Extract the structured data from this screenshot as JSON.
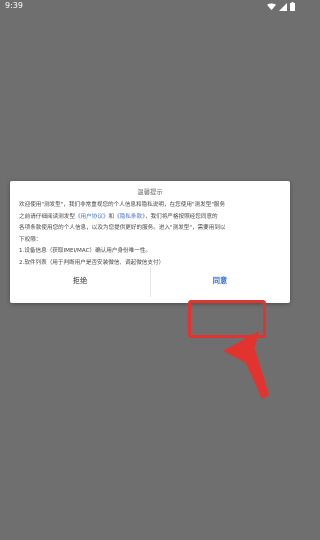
{
  "status_bar": {
    "time": "9:39"
  },
  "dialog": {
    "title": "温馨提示",
    "body": {
      "line1": "欢迎使用\"测发型\"，我们非常重视您的个人信息和隐私说明，在您使用\"测发型\"服务",
      "line2_prefix": "之前请仔细阅读测发型",
      "link_user_agreement": "《用户协议》",
      "line2_and": "和",
      "link_privacy": "《隐私条款》",
      "line2_suffix": "，我们将严格按照经您同意的",
      "line3": "各项条款使用您的个人信息，以及为您提供更好的服务。进入\"测发型\"，需要用到以",
      "line4": "下权限：",
      "line5": "1.设备信息（获取IMEI/MAC）确认用户身份唯一性。",
      "line6": "2.软件列表（用于判断用户是否安装微信、调起微信支付）"
    },
    "reject_label": "拒绝",
    "agree_label": "同意"
  },
  "annotation": {
    "highlight_color": "#e2332e"
  }
}
